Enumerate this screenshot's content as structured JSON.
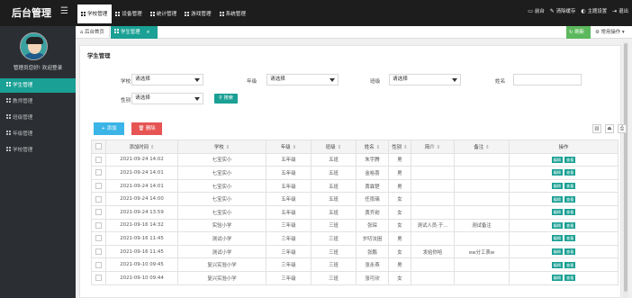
{
  "app": {
    "title": "后台管理",
    "menu_toggle": "☰"
  },
  "topnav": [
    {
      "label": "学校管理",
      "active": true
    },
    {
      "label": "设备管理",
      "active": false
    },
    {
      "label": "统计管理",
      "active": false
    },
    {
      "label": "游戏管理",
      "active": false
    },
    {
      "label": "系统管理",
      "active": false
    }
  ],
  "topright": {
    "front": "前台",
    "clear": "清除缓存",
    "theme": "主题设置",
    "logout": "退出"
  },
  "sidebar": {
    "welcome": "管理员您好! 欢迎登录",
    "items": [
      {
        "label": "学生管理",
        "active": true
      },
      {
        "label": "教师管理",
        "active": false
      },
      {
        "label": "班级管理",
        "active": false
      },
      {
        "label": "年级管理",
        "active": false
      },
      {
        "label": "学校管理",
        "active": false
      }
    ]
  },
  "tabs": {
    "home": "后台首页",
    "current": "学生管理",
    "close": "×",
    "refresh": "刷新",
    "ops": "常用操作"
  },
  "panel": {
    "title": "学生管理"
  },
  "filters": {
    "school_label": "学校",
    "school_value": "请选择",
    "grade_label": "年级",
    "grade_value": "请选择",
    "class_label": "班级",
    "class_value": "请选择",
    "name_label": "姓名",
    "name_value": "",
    "gender_label": "性别",
    "gender_value": "请选择",
    "search": "搜索"
  },
  "toolbar": {
    "add": "+ 添加",
    "delete": "删除"
  },
  "table": {
    "headers": [
      "添加时间",
      "学校",
      "年级",
      "班级",
      "姓名",
      "性别",
      "简介",
      "备注",
      "操作"
    ],
    "edit": "编辑",
    "view": "查看",
    "rows": [
      {
        "time": "2021-09-24 14:02",
        "school": "七宝实小",
        "grade": "五年级",
        "cls": "五班",
        "name": "朱宇腾",
        "gender": "男",
        "intro": "",
        "note": ""
      },
      {
        "time": "2021-09-24 14:01",
        "school": "七宝实小",
        "grade": "五年级",
        "cls": "五班",
        "name": "金裕喜",
        "gender": "男",
        "intro": "",
        "note": ""
      },
      {
        "time": "2021-09-24 14:01",
        "school": "七宝实小",
        "grade": "五年级",
        "cls": "五班",
        "name": "黄霖楚",
        "gender": "男",
        "intro": "",
        "note": ""
      },
      {
        "time": "2021-09-24 14:00",
        "school": "七宝实小",
        "grade": "五年级",
        "cls": "五班",
        "name": "任雨璃",
        "gender": "女",
        "intro": "",
        "note": ""
      },
      {
        "time": "2021-09-24 13:59",
        "school": "七宝实小",
        "grade": "五年级",
        "cls": "五班",
        "name": "黄齐勋",
        "gender": "女",
        "intro": "",
        "note": ""
      },
      {
        "time": "2021-09-16 14:32",
        "school": "实验小学",
        "grade": "三年级",
        "cls": "三班",
        "name": "张琛",
        "gender": "女",
        "intro": "测试人员·于...",
        "note": "测试备注"
      },
      {
        "time": "2021-09-16 11:45",
        "school": "测试小学",
        "grade": "三年级",
        "cls": "三班",
        "name": "岁叨法困",
        "gender": "男",
        "intro": "",
        "note": ""
      },
      {
        "time": "2021-09-16 11:45",
        "school": "测试小学",
        "grade": "三年级",
        "cls": "三班",
        "name": "张鹏",
        "gender": "女",
        "intro": "发给你哈",
        "note": "ew分工表w"
      },
      {
        "time": "2021-09-10 09:45",
        "school": "复兴实验小学",
        "grade": "三年级",
        "cls": "三班",
        "name": "张永燕",
        "gender": "男",
        "intro": "",
        "note": ""
      },
      {
        "time": "2021-09-10 09:44",
        "school": "复兴实验小学",
        "grade": "三年级",
        "cls": "三班",
        "name": "张可欣",
        "gender": "女",
        "intro": "",
        "note": ""
      }
    ]
  },
  "colors": {
    "accent": "#1aa094",
    "topbar": "#1d1d1d",
    "sidebar": "#2b2f33",
    "add": "#3bb4e7",
    "delete": "#e65454",
    "refresh": "#5cb85c"
  }
}
